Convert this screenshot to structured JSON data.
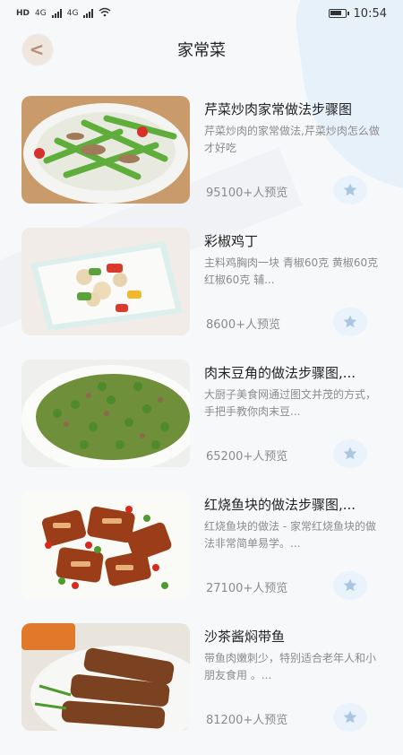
{
  "status": {
    "left": "HD",
    "net1": "4G",
    "net2": "4G",
    "time": "10:54"
  },
  "header": {
    "title": "家常菜"
  },
  "recipes": [
    {
      "title": "芹菜炒肉家常做法步骤图",
      "desc": "芹菜炒肉的家常做法,芹菜炒肉怎么做才好吃",
      "views": "95100+人预览"
    },
    {
      "title": "彩椒鸡丁",
      "desc": "主料鸡胸肉一块    青椒60克    黄椒60克    红椒60克    辅...",
      "views": "8600+人预览"
    },
    {
      "title": "肉末豆角的做法步骤图,...",
      "desc": "大厨子美食网通过图文并茂的方式，手把手教你肉末豆...",
      "views": "65200+人预览"
    },
    {
      "title": "红烧鱼块的做法步骤图,...",
      "desc": "红烧鱼块的做法 - 家常红烧鱼块的做法非常简单易学。...",
      "views": "27100+人预览"
    },
    {
      "title": "沙茶酱焖带鱼",
      "desc": "带鱼肉嫩刺少，特别适合老年人和小朋友食用 。...",
      "views": "81200+人预览"
    }
  ]
}
